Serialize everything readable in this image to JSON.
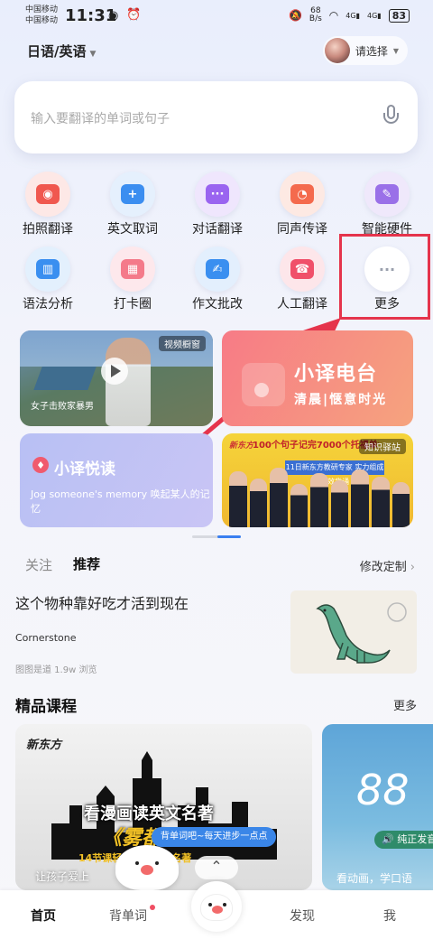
{
  "status_bar": {
    "carrier1": "中国移动",
    "carrier2": "中国移动",
    "time": "11:31",
    "net_speed_value": "68",
    "net_speed_unit": "B/s",
    "signal1": "4G",
    "signal2": "4G",
    "battery": "83"
  },
  "header": {
    "language": "日语/英语",
    "user_prompt": "请选择"
  },
  "search": {
    "placeholder": "输入要翻译的单词或句子"
  },
  "features": [
    {
      "label": "拍照翻译",
      "icon": "camera-icon",
      "color": "#f0584f",
      "bg": "#fde8e6"
    },
    {
      "label": "英文取词",
      "icon": "add-word-icon",
      "color": "#3b8ef0",
      "bg": "#e5f0fd"
    },
    {
      "label": "对话翻译",
      "icon": "chat-icon",
      "color": "#9a64f0",
      "bg": "#efe6fd"
    },
    {
      "label": "同声传译",
      "icon": "head-speech-icon",
      "color": "#f46a4d",
      "bg": "#fde9e3"
    },
    {
      "label": "智能硬件",
      "icon": "pen-device-icon",
      "color": "#9a70e8",
      "bg": "#efe8fb"
    },
    {
      "label": "语法分析",
      "icon": "chart-icon",
      "color": "#3a8ff0",
      "bg": "#e3f0fd"
    },
    {
      "label": "打卡圈",
      "icon": "calendar-icon",
      "color": "#f47a8a",
      "bg": "#fde8ec"
    },
    {
      "label": "作文批改",
      "icon": "essay-icon",
      "color": "#3a8ff0",
      "bg": "#e3effd"
    },
    {
      "label": "人工翻译",
      "icon": "human-translate-icon",
      "color": "#f0506a",
      "bg": "#fde6ea"
    },
    {
      "label": "更多",
      "icon": "more-dots-icon",
      "color": "#9aa0ad",
      "bg": "#ffffff"
    }
  ],
  "cards": {
    "video": {
      "badge": "视频橱窗",
      "caption": "女子击败家暴男"
    },
    "radio": {
      "title": "小译电台",
      "subtitle": "清晨|惬意时光"
    },
    "read": {
      "title": "小译悦读",
      "desc": "Jog someone's memory 唤起某人的记忆"
    },
    "ad": {
      "brand": "新东方",
      "headline": "100个句子记完7000个托福单词",
      "badge": "知识驿站",
      "tag": "11日新东方教研专家 实力组成 高效背诵"
    }
  },
  "feed": {
    "tab_follow": "关注",
    "tab_recommend": "推荐",
    "customize": "修改定制",
    "article": {
      "title": "这个物种靠好吃才活到现在",
      "source": "Cornerstone",
      "meta": "图图是道  1.9w 浏览"
    }
  },
  "courses": {
    "section_title": "精品课程",
    "more": "更多",
    "items": [
      {
        "brand": "新东方",
        "line1": "看漫画读英文名著",
        "line2": "《雾都",
        "line3": "14节课轻松读懂英文名著",
        "caption": "让孩子爱上"
      },
      {
        "num": "88",
        "pill": "纯正发音",
        "caption": "看动画，学口语"
      }
    ],
    "bubble": "背单词吧~每天进步一点点"
  },
  "bottom_nav": {
    "home": "首页",
    "words": "背单词",
    "discover": "发现",
    "me": "我"
  }
}
